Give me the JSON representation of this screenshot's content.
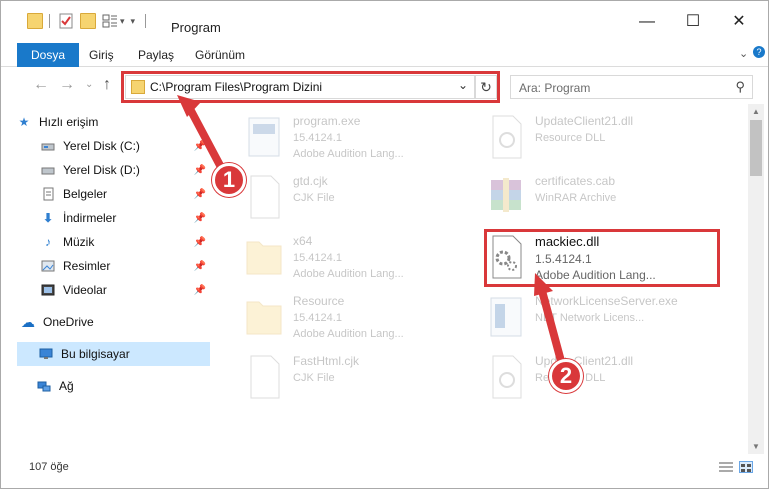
{
  "window": {
    "title": "Program",
    "controls": {
      "minimize": "—",
      "maximize": "☐",
      "close": "✕"
    }
  },
  "ribbon": {
    "tabs": [
      "Dosya",
      "Giriş",
      "Paylaş",
      "Görünüm"
    ]
  },
  "address": {
    "path": "C:\\Program Files\\Program Dizini",
    "search_placeholder": "Ara: Program"
  },
  "sidebar": {
    "items": [
      {
        "label": "Hızlı erişim",
        "icon": "star-icon"
      },
      {
        "label": "Yerel Disk (C:)",
        "icon": "drive-icon",
        "pinned": true
      },
      {
        "label": "Yerel Disk (D:)",
        "icon": "drive-icon",
        "pinned": true
      },
      {
        "label": "Belgeler",
        "icon": "documents-icon",
        "pinned": true
      },
      {
        "label": "İndirmeler",
        "icon": "download-icon",
        "pinned": true
      },
      {
        "label": "Müzik",
        "icon": "music-icon",
        "pinned": true
      },
      {
        "label": "Resimler",
        "icon": "pictures-icon",
        "pinned": true
      },
      {
        "label": "Videolar",
        "icon": "videos-icon",
        "pinned": true
      },
      {
        "label": "OneDrive",
        "icon": "cloud-icon"
      },
      {
        "label": "Bu bilgisayar",
        "icon": "computer-icon",
        "selected": true
      },
      {
        "label": "Ağ",
        "icon": "network-icon"
      }
    ]
  },
  "files": [
    {
      "name": "program.exe",
      "line2": "15.4124.1",
      "line3": "Adobe Audition Lang...",
      "icon": "exe-icon"
    },
    {
      "name": "UpdateClient21.dll",
      "line2": "Resource DLL",
      "line3": "",
      "icon": "dll-icon"
    },
    {
      "name": "gtd.cjk",
      "line2": "CJK File",
      "line3": "",
      "icon": "file-icon"
    },
    {
      "name": "certificates.cab",
      "line2": "WinRAR Archive",
      "line3": "",
      "icon": "archive-icon"
    },
    {
      "name": "x64",
      "line2": "15.4124.1",
      "line3": "Adobe Audition Lang...",
      "icon": "folder-icon"
    },
    {
      "name": "mackiec.dll",
      "line2": "1.5.4124.1",
      "line3": "Adobe Audition Lang...",
      "icon": "dll-gear-icon",
      "highlighted": true
    },
    {
      "name": "Resource",
      "line2": "15.4124.1",
      "line3": "Adobe Audition Lang...",
      "icon": "folder-icon"
    },
    {
      "name": "NetworkLicenseServer.exe",
      "line2": "NET Network Licens...",
      "line3": "",
      "icon": "exe-icon"
    },
    {
      "name": "FastHtml.cjk",
      "line2": "CJK File",
      "line3": "",
      "icon": "file-icon"
    },
    {
      "name": "UpdateClient21.dll",
      "line2": "Resource DLL",
      "line3": "",
      "icon": "dll-icon"
    }
  ],
  "status": {
    "count": "107 öğe"
  },
  "callouts": [
    "1",
    "2"
  ],
  "colors": {
    "accent": "#1979ca",
    "highlight": "#d9383a",
    "selected_bg": "#cce8ff"
  }
}
